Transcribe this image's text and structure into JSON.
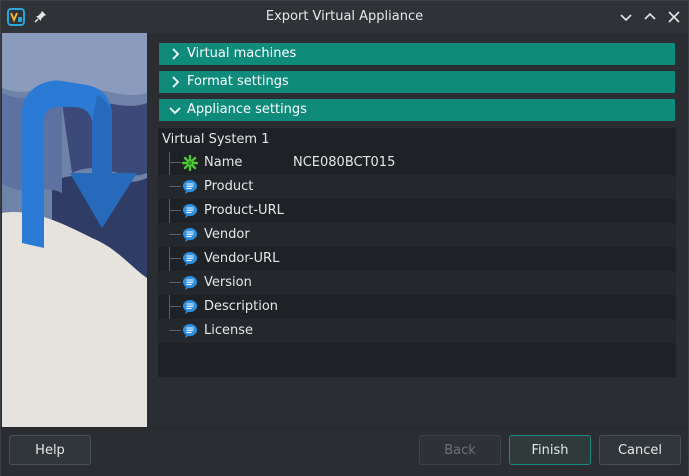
{
  "window": {
    "title": "Export Virtual Appliance"
  },
  "icons": {
    "app": "virtualbox-app-icon",
    "pin": "pin-icon",
    "minimize": "chevron-down-icon",
    "maximize": "chevron-up-icon",
    "close": "close-icon"
  },
  "sections": [
    {
      "label": "Virtual machines",
      "expanded": false
    },
    {
      "label": "Format settings",
      "expanded": false
    },
    {
      "label": "Appliance settings",
      "expanded": true
    }
  ],
  "appliance": {
    "root_label": "Virtual System 1",
    "rows": [
      {
        "label": "Name",
        "value": "NCE080BCT015",
        "icon": "name-icon"
      },
      {
        "label": "Product",
        "value": "",
        "icon": "description-icon"
      },
      {
        "label": "Product-URL",
        "value": "",
        "icon": "description-icon"
      },
      {
        "label": "Vendor",
        "value": "",
        "icon": "description-icon"
      },
      {
        "label": "Vendor-URL",
        "value": "",
        "icon": "description-icon"
      },
      {
        "label": "Version",
        "value": "",
        "icon": "description-icon"
      },
      {
        "label": "Description",
        "value": "",
        "icon": "description-icon"
      },
      {
        "label": "License",
        "value": "",
        "icon": "description-icon"
      }
    ]
  },
  "buttons": {
    "help": "Help",
    "back": "Back",
    "finish": "Finish",
    "cancel": "Cancel"
  },
  "colors": {
    "section_header": "#0f8b7c",
    "window_bg": "#2a2e32",
    "tree_bg": "#1e2125"
  }
}
